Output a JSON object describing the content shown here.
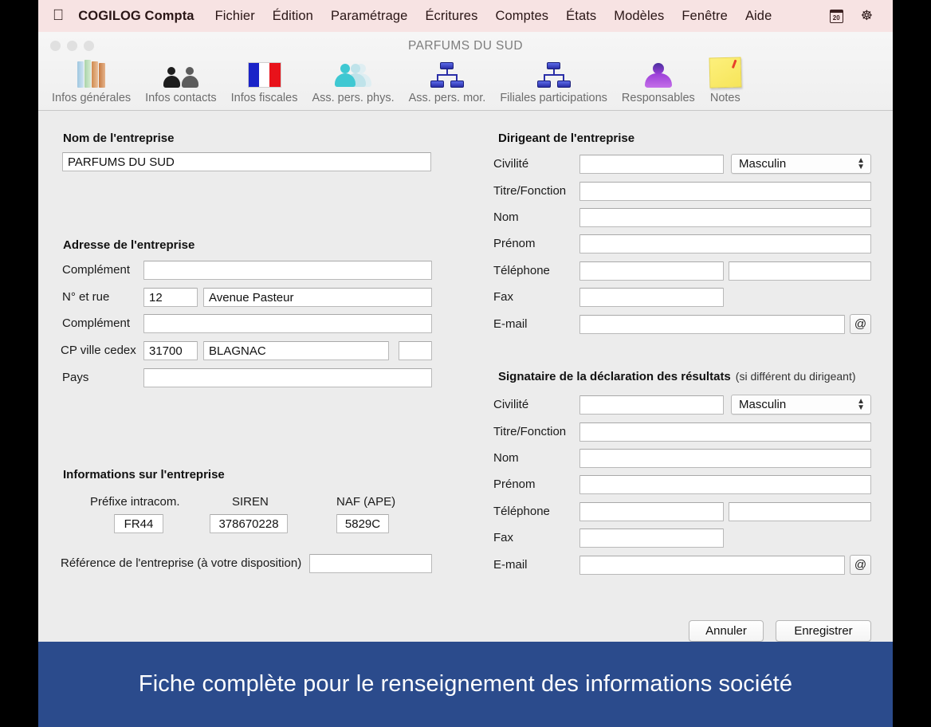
{
  "colors": {
    "menubar_bg": "#f7e3e3",
    "window_bg": "#ececec",
    "caption_bg": "#2b4b8c",
    "toolbar_label": "#6d6d6d"
  },
  "menubar": {
    "apple_glyph": "",
    "items": [
      {
        "label": "COGILOG Compta",
        "bold": true
      },
      {
        "label": "Fichier"
      },
      {
        "label": "Édition"
      },
      {
        "label": "Paramétrage"
      },
      {
        "label": "Écritures"
      },
      {
        "label": "Comptes"
      },
      {
        "label": "États"
      },
      {
        "label": "Modèles"
      },
      {
        "label": "Fenêtre"
      },
      {
        "label": "Aide"
      }
    ],
    "status": {
      "calendar_day": "20",
      "gear_glyph": "☸"
    }
  },
  "window": {
    "title": "PARFUMS DU SUD",
    "toolbar": [
      {
        "label": "Infos générales",
        "icon": "books-icon"
      },
      {
        "label": "Infos contacts",
        "icon": "people-icon"
      },
      {
        "label": "Infos fiscales",
        "icon": "french-flag-icon"
      },
      {
        "label": "Ass. pers. phys.",
        "icon": "person-stack-icon"
      },
      {
        "label": "Ass. pers. mor.",
        "icon": "org-chart-icon"
      },
      {
        "label": "Filiales participations",
        "icon": "org-chart-icon"
      },
      {
        "label": "Responsables",
        "icon": "avatar-icon"
      },
      {
        "label": "Notes",
        "icon": "note-icon"
      }
    ]
  },
  "left": {
    "company_name": {
      "heading": "Nom de l'entreprise",
      "value": "PARFUMS DU SUD"
    },
    "address": {
      "heading": "Adresse de l'entreprise",
      "complement1_label": "Complément",
      "complement1_value": "",
      "street_label": "N° et rue",
      "street_number": "12",
      "street_name": "Avenue Pasteur",
      "complement2_label": "Complément",
      "complement2_value": "",
      "cp_label": "CP ville cedex",
      "cp_value": "31700",
      "city_value": "BLAGNAC",
      "cedex_value": "",
      "country_label": "Pays",
      "country_value": ""
    },
    "info": {
      "heading": "Informations sur l'entreprise",
      "prefix_label": "Préfixe intracom.",
      "prefix_value": "FR44",
      "siren_label": "SIREN",
      "siren_value": "378670228",
      "naf_label": "NAF (APE)",
      "naf_value": "5829C",
      "reference_label": "Référence de l'entreprise (à votre disposition)",
      "reference_value": ""
    }
  },
  "right": {
    "dirigeant": {
      "heading": "Dirigeant de l'entreprise",
      "heading_sub": "",
      "civilite_label": "Civilité",
      "civilite_value": "",
      "genre_selected": "Masculin",
      "titre_label": "Titre/Fonction",
      "titre_value": "",
      "nom_label": "Nom",
      "nom_value": "",
      "prenom_label": "Prénom",
      "prenom_value": "",
      "tel_label": "Téléphone",
      "tel_value": "",
      "tel2_value": "",
      "fax_label": "Fax",
      "fax_value": "",
      "email_label": "E-mail",
      "email_value": "",
      "email_button": "@"
    },
    "signataire": {
      "heading": "Signataire de la déclaration des résultats",
      "heading_sub": "(si différent du dirigeant)",
      "civilite_label": "Civilité",
      "civilite_value": "",
      "genre_selected": "Masculin",
      "titre_label": "Titre/Fonction",
      "titre_value": "",
      "nom_label": "Nom",
      "nom_value": "",
      "prenom_label": "Prénom",
      "prenom_value": "",
      "tel_label": "Téléphone",
      "tel_value": "",
      "tel2_value": "",
      "fax_label": "Fax",
      "fax_value": "",
      "email_label": "E-mail",
      "email_value": "",
      "email_button": "@"
    }
  },
  "footer": {
    "cancel_label": "Annuler",
    "save_label": "Enregistrer"
  },
  "caption": {
    "text": "Fiche complète pour le renseignement des informations société"
  }
}
